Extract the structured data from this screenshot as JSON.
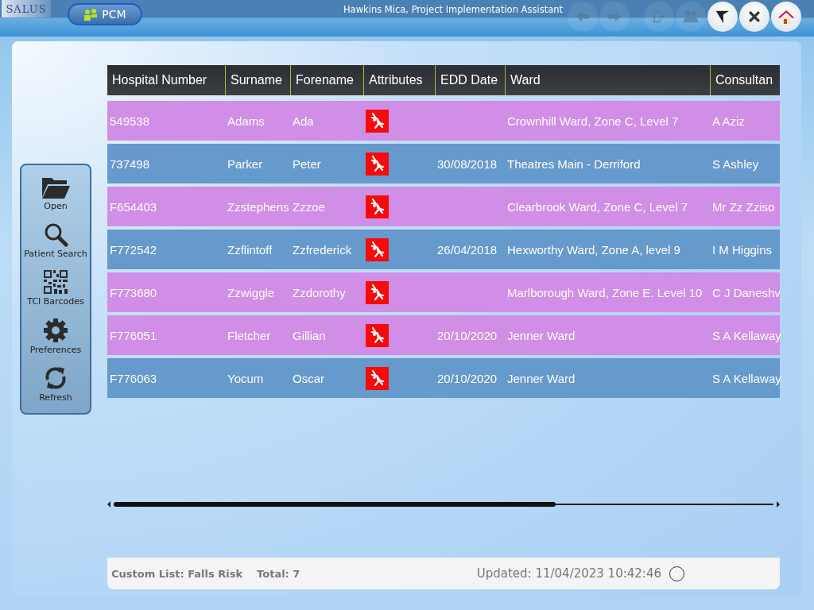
{
  "app": {
    "logo": "SALUS",
    "module_button": "PCM",
    "user": "Hawkins Mica, Project Implementation Assistant"
  },
  "toolbar": [
    {
      "kind": "back",
      "disabled": true
    },
    {
      "kind": "forward",
      "disabled": true
    },
    {
      "kind": "logout",
      "disabled": true
    },
    {
      "kind": "switch-user",
      "disabled": true
    },
    {
      "kind": "filter",
      "disabled": false
    },
    {
      "kind": "close",
      "disabled": false
    },
    {
      "kind": "home",
      "disabled": false
    }
  ],
  "sidebar": [
    {
      "kind": "open",
      "label": "Open"
    },
    {
      "kind": "search",
      "label": "Patient Search"
    },
    {
      "kind": "qr",
      "label": "TCI Barcodes"
    },
    {
      "kind": "gear",
      "label": "Preferences"
    },
    {
      "kind": "refresh",
      "label": "Refresh"
    }
  ],
  "table": {
    "columns": [
      "Hospital Number",
      "Surname",
      "Forename",
      "Attributes",
      "EDD Date",
      "Ward",
      "Consultan"
    ],
    "rows": [
      {
        "color": "#d08ee6",
        "cells": [
          "549538",
          "Adams",
          "Ada",
          "",
          "",
          "Crownhill Ward, Zone C, Level 7",
          "A Aziz"
        ],
        "falls_risk": true
      },
      {
        "color": "#6699cc",
        "cells": [
          "737498",
          "Parker",
          "Peter",
          "",
          "30/08/2018",
          "Theatres Main - Derriford",
          "S Ashley"
        ],
        "falls_risk": true
      },
      {
        "color": "#d08ee6",
        "cells": [
          "F654403",
          "Zzstephens",
          "Zzzoe",
          "",
          "",
          "Clearbrook Ward, Zone C, Level 7",
          "Mr Zz Zziso"
        ],
        "falls_risk": true
      },
      {
        "color": "#6699cc",
        "cells": [
          "F772542",
          "Zzflintoff",
          "Zzfrederick",
          "",
          "26/04/2018",
          "Hexworthy Ward, Zone A, level 9",
          "I M Higgins"
        ],
        "falls_risk": true
      },
      {
        "color": "#d08ee6",
        "cells": [
          "F773680",
          "Zzwiggle",
          "Zzdorothy",
          "",
          "",
          "Marlborough Ward, Zone E. Level 10",
          "C J Daneshv"
        ],
        "falls_risk": true
      },
      {
        "color": "#d08ee6",
        "cells": [
          "F776051",
          "Fletcher",
          "Gillian",
          "",
          "20/10/2020",
          "Jenner Ward",
          "S A Kellaway"
        ],
        "falls_risk": true
      },
      {
        "color": "#6699cc",
        "cells": [
          "F776063",
          "Yocum",
          "Oscar",
          "",
          "20/10/2020",
          "Jenner Ward",
          "S A Kellaway"
        ],
        "falls_risk": true
      }
    ]
  },
  "status_bar": {
    "list": "Custom List: Falls Risk",
    "total": "Total: 7",
    "updated": "Updated: 11/04/2023 10:42:46"
  }
}
